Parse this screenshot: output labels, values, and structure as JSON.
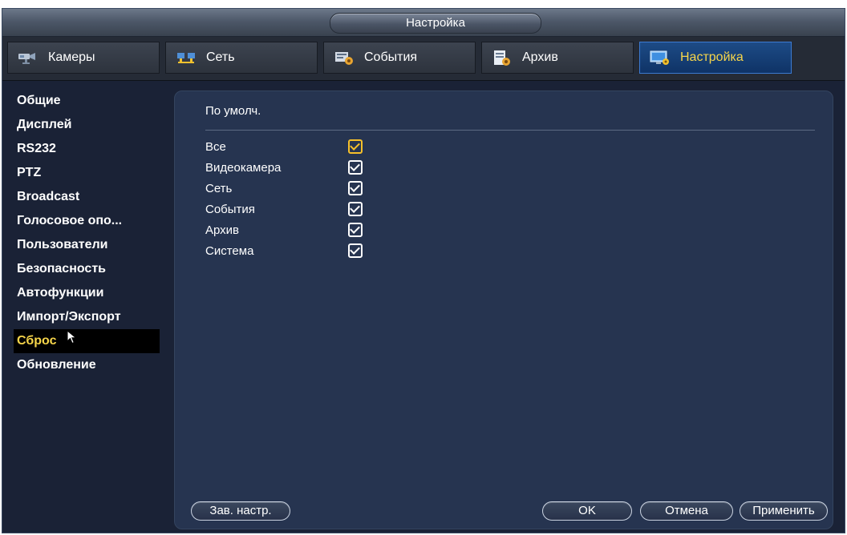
{
  "window": {
    "title": "Настройка"
  },
  "tabs": [
    {
      "label": "Камеры",
      "icon": "cameras-icon"
    },
    {
      "label": "Сеть",
      "icon": "network-icon"
    },
    {
      "label": "События",
      "icon": "events-icon"
    },
    {
      "label": "Архив",
      "icon": "archive-icon"
    },
    {
      "label": "Настройка",
      "icon": "settings-icon",
      "active": true
    }
  ],
  "sidebar": {
    "items": [
      {
        "label": "Общие"
      },
      {
        "label": "Дисплей"
      },
      {
        "label": "RS232"
      },
      {
        "label": "PTZ"
      },
      {
        "label": "Broadcast"
      },
      {
        "label": "Голосовое опо..."
      },
      {
        "label": "Пользователи"
      },
      {
        "label": "Безопасность"
      },
      {
        "label": "Автофункции"
      },
      {
        "label": "Импорт/Экспорт"
      },
      {
        "label": "Сброс",
        "active": true
      },
      {
        "label": "Обновление"
      }
    ]
  },
  "main": {
    "section_title": "По умолч.",
    "options": [
      {
        "label": "Все",
        "checked": true,
        "highlighted": true
      },
      {
        "label": "Видеокамера",
        "checked": true
      },
      {
        "label": "Сеть",
        "checked": true
      },
      {
        "label": "События",
        "checked": true
      },
      {
        "label": "Архив",
        "checked": true
      },
      {
        "label": "Система",
        "checked": true
      }
    ]
  },
  "buttons": {
    "factory": "Зав. настр.",
    "ok": "OK",
    "cancel": "Отмена",
    "apply": "Применить"
  },
  "colors": {
    "accent": "#f6d54a",
    "panel": "#263450",
    "active_tab": "#1d4b86"
  }
}
